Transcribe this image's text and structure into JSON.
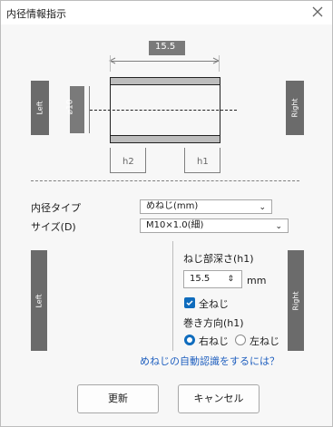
{
  "window": {
    "title": "内径情報指示"
  },
  "diagram": {
    "length": "15.5",
    "diameter": "⌀10",
    "h1": "h1",
    "h2": "h2",
    "left": "Left",
    "right": "Right"
  },
  "form": {
    "type_label": "内径タイプ",
    "type_value": "めねじ(mm)",
    "size_label": "サイズ(D)",
    "size_value": "M10×1.0(細)",
    "left_side": "Left",
    "right_side": "Right",
    "depth_label": "ねじ部深さ(h1)",
    "depth_value": "15.5",
    "depth_unit": "mm",
    "full_thread_label": "全ねじ",
    "direction_label": "巻き方向(h1)",
    "right_thread": "右ねじ",
    "left_thread": "左ねじ",
    "help_link": "めねじの自動認識をするには？"
  },
  "buttons": {
    "update": "更新",
    "cancel": "キャンセル"
  }
}
